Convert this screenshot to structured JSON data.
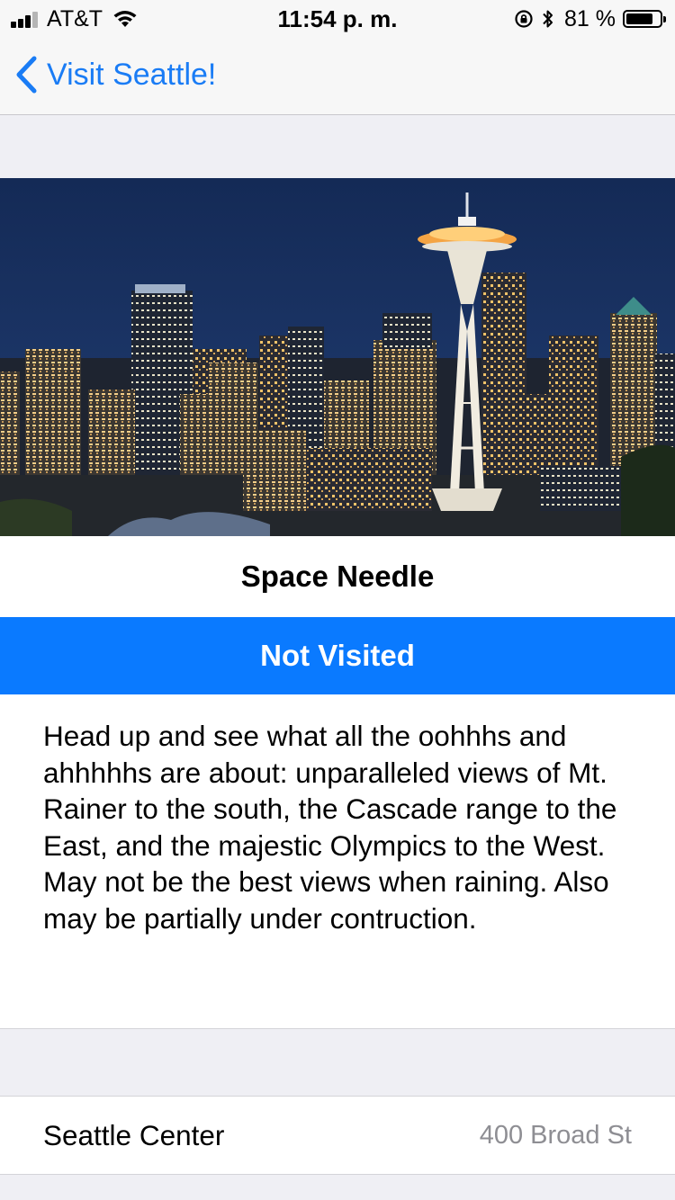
{
  "status_bar": {
    "carrier": "AT&T",
    "time": "11:54 p. m.",
    "battery_percent": "81 %",
    "battery_level": 0.81,
    "icons": [
      "signal-icon",
      "wifi-icon",
      "rotation-lock-icon",
      "bluetooth-icon",
      "battery-icon"
    ]
  },
  "nav": {
    "back_label": "Visit Seattle!",
    "back_icon": "chevron-left-icon",
    "accent_color": "#1a7cf5"
  },
  "hero": {
    "image": "seattle-skyline-space-needle-photo"
  },
  "place": {
    "title": "Space Needle",
    "visit_status": "Not Visited",
    "visit_color": "#0a7aff",
    "description": "Head up and see what all the oohhhs and ahhhhhs are about: unparalleled views of Mt. Rainer to the south, the Cascade range to the East, and the majestic Olympics to the West. May not be the best views when raining. Also may be partially under contruction."
  },
  "location": {
    "name": "Seattle Center",
    "address": "400 Broad St"
  }
}
